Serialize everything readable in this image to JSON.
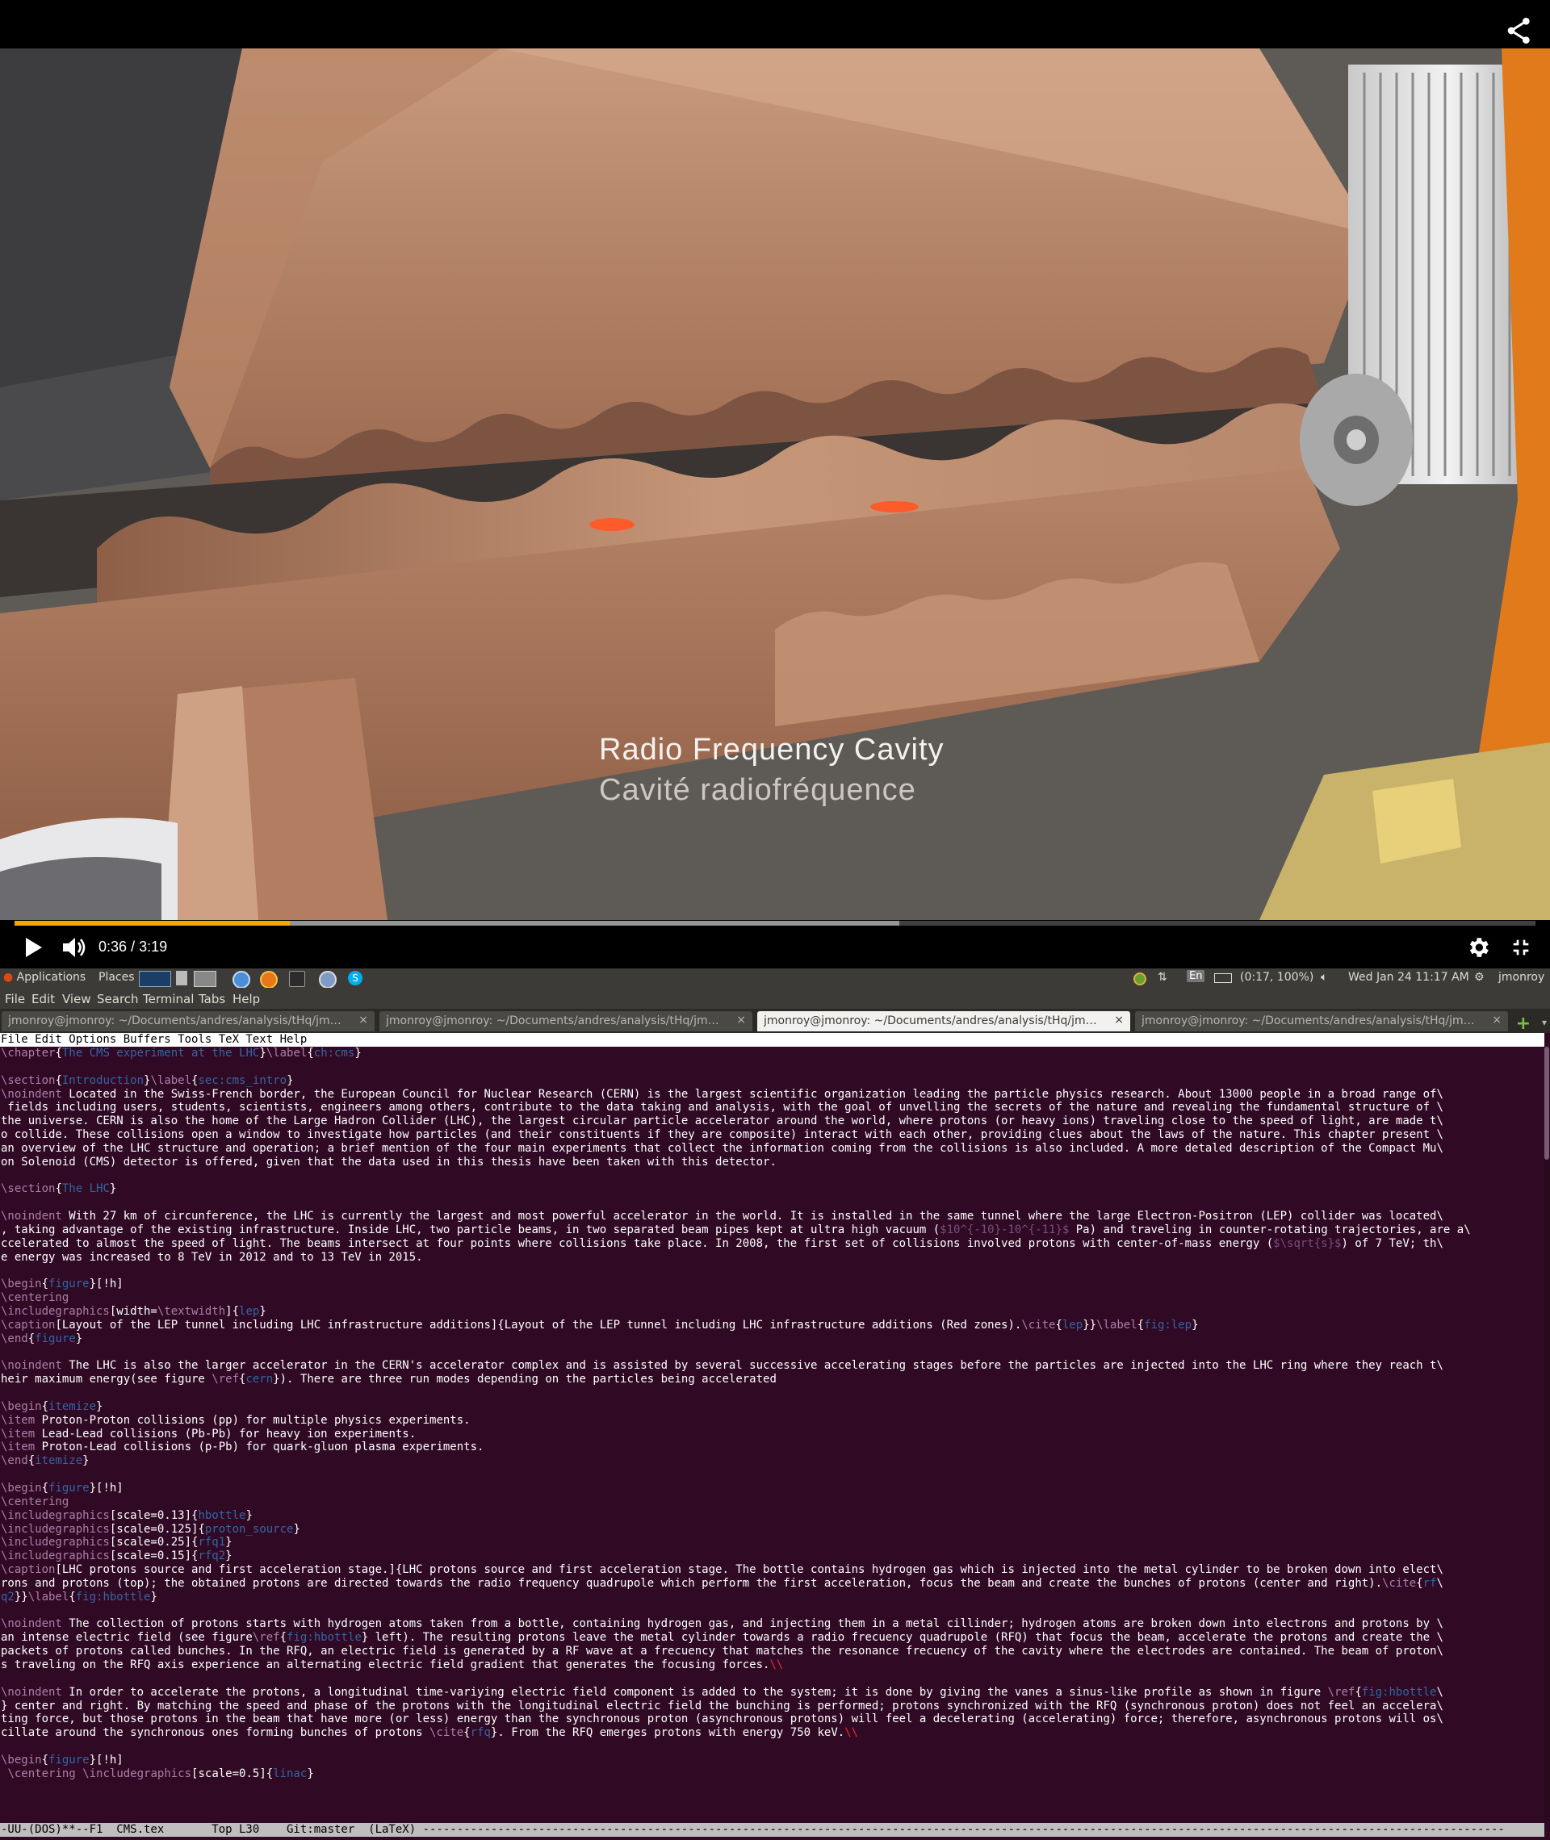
{
  "player": {
    "caption_en": "Radio Frequency Cavity",
    "caption_fr": "Cavité radiofréquence",
    "time_current": "0:36",
    "time_separator": "/",
    "time_total": "3:19",
    "progress_played_fraction": 0.181,
    "progress_buffered_fraction": 0.582,
    "progress_color": "#f2a900",
    "icons": [
      "share-icon",
      "play-icon",
      "volume-icon",
      "settings-gear-icon",
      "exit-fullscreen-icon"
    ]
  },
  "panel": {
    "applications": "Applications",
    "places": "Places",
    "network_status": "(0:17, 100%)",
    "keyboard_layout": "En",
    "clock": "Wed Jan 24 11:17 AM",
    "user": "jmonroy"
  },
  "terminal": {
    "menu": [
      "File",
      "Edit",
      "View",
      "Search",
      "Terminal",
      "Tabs",
      "Help"
    ],
    "tabs": [
      {
        "label": "jmonroy@jmonroy: ~/Documents/andres/analysis/tHq/jmon...",
        "active": false
      },
      {
        "label": "jmonroy@jmonroy: ~/Documents/andres/analysis/tHq/jmon...",
        "active": false
      },
      {
        "label": "jmonroy@jmonroy: ~/Documents/andres/analysis/tHq/jmon...",
        "active": true
      },
      {
        "label": "jmonroy@jmonroy: ~/Documents/andres/analysis/tHq/jmon...",
        "active": false
      }
    ],
    "tab_close": "×",
    "new_tab": "+",
    "tab_menu": "▾"
  },
  "emacs": {
    "menubar": "File Edit Options Buffers Tools TeX Text Help",
    "modeline": "-UU-(DOS)**--F1  CMS.tex       Top L30    Git:master  (LaTeX) ---------------------------------------------------------------------------------------------------------------------------------------------------------------",
    "lines": [
      [
        [
          "k",
          "\\chapter"
        ],
        [
          "",
          "{"
        ],
        [
          "a",
          "The CMS experiment at the LHC"
        ],
        [
          "",
          "}"
        ],
        [
          "k",
          "\\label"
        ],
        [
          "",
          "{"
        ],
        [
          "a",
          "ch:cms"
        ],
        [
          "",
          "}"
        ]
      ],
      [],
      [
        [
          "k",
          "\\section"
        ],
        [
          "",
          "{"
        ],
        [
          "a",
          "Introduction"
        ],
        [
          "",
          "}"
        ],
        [
          "k",
          "\\label"
        ],
        [
          "",
          "{"
        ],
        [
          "a",
          "sec:cms_intro"
        ],
        [
          "",
          "}"
        ]
      ],
      [
        [
          "k",
          "\\noindent"
        ],
        [
          "",
          " Located in the Swiss-French border, the European Council for Nuclear Research (CERN) is the largest scientific organization leading the particle physics research. About 13000 people in a broad range of\\"
        ]
      ],
      [
        [
          "",
          " fields including users, students, scientists, engineers among others, contribute to the data taking and analysis, with the goal of unvelling the secrets of the nature and revealing the fundamental structure of \\"
        ]
      ],
      [
        [
          "",
          "the universe. CERN is also the home of the Large Hadron Collider (LHC), the largest circular particle accelerator around the world, where protons (or heavy ions) traveling close to the speed of light, are made t\\"
        ]
      ],
      [
        [
          "",
          "o collide. These collisions open a window to investigate how particles (and their constituents if they are composite) interact with each other, providing clues about the laws of the nature. This chapter present \\"
        ]
      ],
      [
        [
          "",
          "an overview of the LHC structure and operation; a brief mention of the four main experiments that collect the information coming from the collisions is also included. A more detaled description of the Compact Mu\\"
        ]
      ],
      [
        [
          "",
          "on Solenoid (CMS) detector is offered, given that the data used in this thesis have been taken with this detector."
        ]
      ],
      [],
      [
        [
          "k",
          "\\section"
        ],
        [
          "",
          "{"
        ],
        [
          "a",
          "The LHC"
        ],
        [
          "",
          "}"
        ]
      ],
      [],
      [
        [
          "k",
          "\\noindent"
        ],
        [
          "",
          " With 27 km of circunference, the LHC is currently the largest and most powerful accelerator in the world. It is installed in the same tunnel where the large Electron-Positron (LEP) collider was located\\"
        ]
      ],
      [
        [
          "",
          ", taking advantage of the existing infrastructure. Inside LHC, two particle beams, in two separated beam pipes kept at ultra high vacuum ("
        ],
        [
          "m",
          "$10^{-10}-10^{-11}$"
        ],
        [
          "",
          " Pa) and traveling in counter-rotating trajectories, are a\\"
        ]
      ],
      [
        [
          "",
          "ccelerated to almost the speed of light. The beams intersect at four points where collisions take place. In 2008, the first set of collisions involved protons with center-of-mass energy ("
        ],
        [
          "m",
          "$\\sqrt{s}$"
        ],
        [
          "",
          ") of 7 TeV; th\\"
        ]
      ],
      [
        [
          "",
          "e energy was increased to 8 TeV in 2012 and to 13 TeV in 2015."
        ]
      ],
      [],
      [
        [
          "k",
          "\\begin"
        ],
        [
          "",
          "{"
        ],
        [
          "a",
          "figure"
        ],
        [
          "",
          "}[!h]"
        ]
      ],
      [
        [
          "k",
          "\\centering"
        ]
      ],
      [
        [
          "k",
          "\\includegraphics"
        ],
        [
          "",
          "[width="
        ],
        [
          "k",
          "\\textwidth"
        ],
        [
          "",
          "]{"
        ],
        [
          "a",
          "lep"
        ],
        [
          "",
          "}"
        ]
      ],
      [
        [
          "k",
          "\\caption"
        ],
        [
          "",
          "[Layout of the LEP tunnel including LHC infrastructure additions]{Layout of the LEP tunnel including LHC infrastructure additions (Red zones)."
        ],
        [
          "k",
          "\\cite"
        ],
        [
          "",
          "{"
        ],
        [
          "a",
          "lep"
        ],
        [
          "",
          "}}"
        ],
        [
          "k",
          "\\label"
        ],
        [
          "",
          "{"
        ],
        [
          "a",
          "fig:lep"
        ],
        [
          "",
          "}"
        ]
      ],
      [
        [
          "k",
          "\\end"
        ],
        [
          "",
          "{"
        ],
        [
          "a",
          "figure"
        ],
        [
          "",
          "}"
        ]
      ],
      [],
      [
        [
          "k",
          "\\noindent"
        ],
        [
          "",
          " The LHC is also the larger accelerator in the CERN's accelerator complex and is assisted by several successive accelerating stages before the particles are injected into the LHC ring where they reach t\\"
        ]
      ],
      [
        [
          "",
          "heir maximum energy(see figure "
        ],
        [
          "k",
          "\\ref"
        ],
        [
          "",
          "{"
        ],
        [
          "a",
          "cern"
        ],
        [
          "",
          "}). There are three run modes depending on the particles being accelerated"
        ]
      ],
      [],
      [
        [
          "k",
          "\\begin"
        ],
        [
          "",
          "{"
        ],
        [
          "a",
          "itemize"
        ],
        [
          "",
          "}"
        ]
      ],
      [
        [
          "k",
          "\\item"
        ],
        [
          "",
          " Proton-Proton collisions (pp) for multiple physics experiments."
        ]
      ],
      [
        [
          "k",
          "\\item"
        ],
        [
          "",
          " Lead-Lead collisions (Pb-Pb) for heavy ion experiments."
        ]
      ],
      [
        [
          "k",
          "\\item"
        ],
        [
          "",
          " Proton-Lead collisions (p-Pb) for quark-gluon plasma experiments."
        ]
      ],
      [
        [
          "k",
          "\\end"
        ],
        [
          "",
          "{"
        ],
        [
          "a",
          "itemize"
        ],
        [
          "",
          "}"
        ]
      ],
      [],
      [
        [
          "k",
          "\\begin"
        ],
        [
          "",
          "{"
        ],
        [
          "a",
          "figure"
        ],
        [
          "",
          "}[!h]"
        ]
      ],
      [
        [
          "k",
          "\\centering"
        ]
      ],
      [
        [
          "k",
          "\\includegraphics"
        ],
        [
          "",
          "[scale=0.13]{"
        ],
        [
          "a",
          "hbottle"
        ],
        [
          "",
          "}"
        ]
      ],
      [
        [
          "k",
          "\\includegraphics"
        ],
        [
          "",
          "[scale=0.125]{"
        ],
        [
          "a",
          "proton_source"
        ],
        [
          "",
          "}"
        ]
      ],
      [
        [
          "k",
          "\\includegraphics"
        ],
        [
          "",
          "[scale=0.25]{"
        ],
        [
          "a",
          "rfq1"
        ],
        [
          "",
          "}"
        ]
      ],
      [
        [
          "k",
          "\\includegraphics"
        ],
        [
          "",
          "[scale=0.15]{"
        ],
        [
          "a",
          "rfq2"
        ],
        [
          "",
          "}"
        ]
      ],
      [
        [
          "k",
          "\\caption"
        ],
        [
          "",
          "[LHC protons source and first acceleration stage.]{LHC protons source and first acceleration stage. The bottle contains hydrogen gas which is injected into the metal cylinder to be broken down into elect\\"
        ]
      ],
      [
        [
          "",
          "rons and protons (top); the obtained protons are directed towards the radio frequency quadrupole which perform the first acceleration, focus the beam and create the bunches of protons (center and right)."
        ],
        [
          "k",
          "\\cite"
        ],
        [
          "",
          "{"
        ],
        [
          "a",
          "rf"
        ],
        [
          "",
          "\\"
        ]
      ],
      [
        [
          "a",
          "q2"
        ],
        [
          "",
          "}}"
        ],
        [
          "k",
          "\\label"
        ],
        [
          "",
          "{"
        ],
        [
          "a",
          "fig:hbottle"
        ],
        [
          "",
          "}"
        ]
      ],
      [],
      [
        [
          "k",
          "\\noindent"
        ],
        [
          "",
          " The collection of protons starts with hydrogen atoms taken from a bottle, containing hydrogen gas, and injecting them in a metal cillinder; hydrogen atoms are broken down into electrons and protons by \\"
        ]
      ],
      [
        [
          "",
          "an intense electric field (see figure"
        ],
        [
          "k",
          "\\ref"
        ],
        [
          "",
          "{"
        ],
        [
          "a",
          "fig:hbottle"
        ],
        [
          "",
          "} left). The resulting protons leave the metal cylinder towards a radio frecuency quadrupole (RFQ) that focus the beam, accelerate the protons and create the \\"
        ]
      ],
      [
        [
          "",
          "packets of protons called bunches. In the RFQ, an electric field is generated by a RF wave at a frecuency that matches the resonance frecuency of the cavity where the electrodes are contained. The beam of proton\\"
        ]
      ],
      [
        [
          "",
          "s traveling on the RFQ axis experience an alternating electric field gradient that generates the focusing forces."
        ],
        [
          "r",
          "\\\\"
        ]
      ],
      [],
      [
        [
          "k",
          "\\noindent"
        ],
        [
          "",
          " In order to accelerate the protons, a longitudinal time-variying electric field component is added to the system; it is done by giving the vanes a sinus-like profile as shown in figure "
        ],
        [
          "k",
          "\\ref"
        ],
        [
          "",
          "{"
        ],
        [
          "a",
          "fig:hbottle"
        ],
        [
          "",
          "\\"
        ]
      ],
      [
        [
          "",
          "} center and right. By matching the speed and phase of the protons with the longitudinal electric field the bunching is performed; protons synchronized with the RFQ (synchronous proton) does not feel an accelera\\"
        ]
      ],
      [
        [
          "",
          "ting force, but those protons in the beam that have more (or less) energy than the synchronous proton (asynchronous protons) will feel a decelerating (accelerating) force; therefore, asynchronous protons will os\\"
        ]
      ],
      [
        [
          "",
          "cillate around the synchronous ones forming bunches of protons "
        ],
        [
          "k",
          "\\cite"
        ],
        [
          "",
          "{"
        ],
        [
          "a",
          "rfq"
        ],
        [
          "",
          "}. From the RFQ emerges protons with energy 750 keV."
        ],
        [
          "r",
          "\\\\"
        ]
      ],
      [],
      [
        [
          "k",
          "\\begin"
        ],
        [
          "",
          "{"
        ],
        [
          "a",
          "figure"
        ],
        [
          "",
          "}[!h]"
        ]
      ],
      [
        [
          "",
          " "
        ],
        [
          "k",
          "\\centering"
        ],
        [
          "",
          " "
        ],
        [
          "k",
          "\\includegraphics"
        ],
        [
          "",
          "[scale=0.5]{"
        ],
        [
          "a",
          "linac"
        ],
        [
          "",
          "}"
        ]
      ]
    ]
  }
}
